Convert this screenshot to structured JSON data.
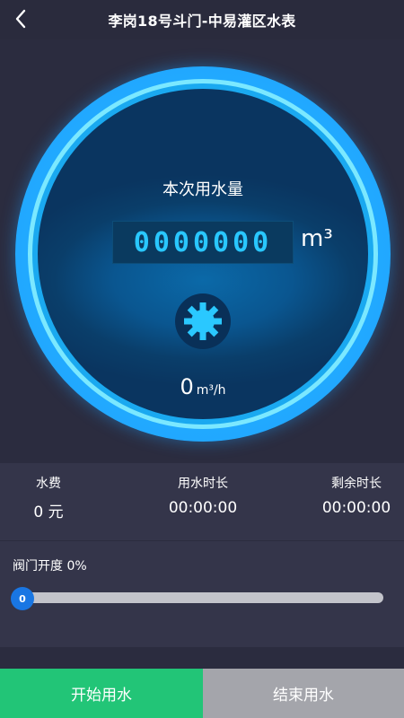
{
  "header": {
    "title": "李岗18号斗门-中易灌区水表",
    "back_icon": "chevron-left-icon"
  },
  "meter": {
    "label": "本次用水量",
    "reading": "0000000",
    "unit": "m³",
    "icon": "gear-icon",
    "flow_value": "0",
    "flow_unit": "m³/h",
    "colors": {
      "ring": "#20a6ff",
      "digits": "#29c7ff",
      "dial": "#0a3e6a"
    }
  },
  "stats": [
    {
      "label": "水费",
      "value": "0 元"
    },
    {
      "label": "用水时长",
      "value": "00:00:00"
    },
    {
      "label": "剩余时长",
      "value": "00:00:00"
    }
  ],
  "valve": {
    "label": "阀门开度 0%",
    "percent": 0,
    "thumb_text": "0"
  },
  "actions": {
    "start_label": "开始用水",
    "end_label": "结束用水",
    "start_color": "#22c577",
    "end_color": "#a4a5ab"
  }
}
